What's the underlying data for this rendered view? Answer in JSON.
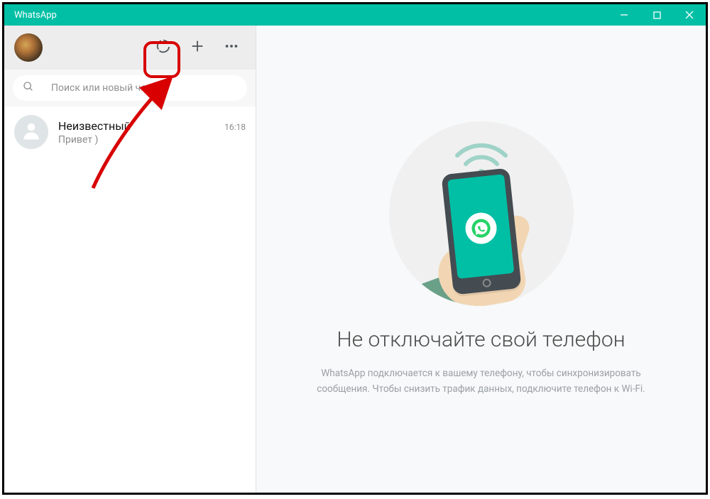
{
  "window": {
    "title": "WhatsApp"
  },
  "search": {
    "placeholder": "Поиск или новый чат"
  },
  "chats": [
    {
      "name": "Неизвестный",
      "message": "Привет )",
      "time": "16:18"
    }
  ],
  "placeholder": {
    "title": "Не отключайте свой телефон",
    "line1": "WhatsApp подключается к вашему телефону, чтобы синхронизировать",
    "line2": "сообщения. Чтобы снизить трафик данных, подключите телефон к Wi-Fi."
  }
}
